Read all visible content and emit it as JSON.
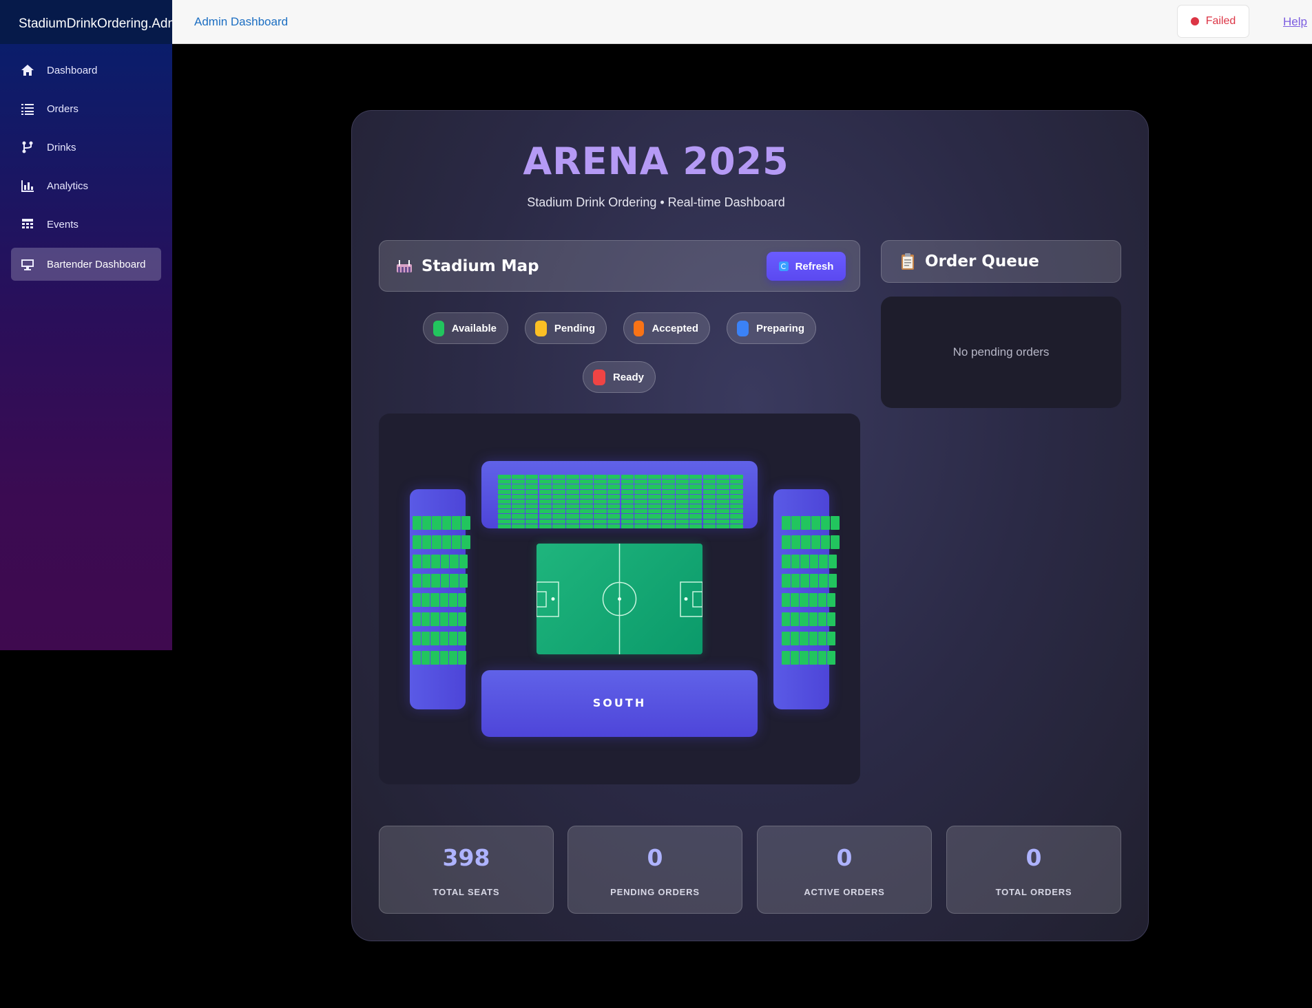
{
  "app": {
    "brand": "StadiumDrinkOrdering.Admin"
  },
  "topbar": {
    "link": "Admin Dashboard",
    "status": "Failed",
    "help": "Help",
    "status_color": "#dc3545"
  },
  "sidebar": {
    "items": [
      {
        "label": "Dashboard",
        "icon": "home-icon"
      },
      {
        "label": "Orders",
        "icon": "list-icon"
      },
      {
        "label": "Drinks",
        "icon": "fork-icon"
      },
      {
        "label": "Analytics",
        "icon": "bar-chart-icon"
      },
      {
        "label": "Events",
        "icon": "calendar-grid-icon"
      },
      {
        "label": "Bartender Dashboard",
        "icon": "monitor-icon",
        "active": true
      }
    ]
  },
  "header": {
    "title": "ARENA 2025",
    "subtitle": "Stadium Drink Ordering • Real-time Dashboard"
  },
  "map_card": {
    "title": "Stadium Map",
    "refresh": "Refresh",
    "icon": "stadium-icon"
  },
  "queue_card": {
    "title": "Order Queue",
    "empty": "No pending orders",
    "icon": "clipboard-icon"
  },
  "legend": [
    {
      "label": "Available",
      "color": "#22c55e"
    },
    {
      "label": "Pending",
      "color": "#fbbf24"
    },
    {
      "label": "Accepted",
      "color": "#f97316"
    },
    {
      "label": "Preparing",
      "color": "#3b82f6"
    },
    {
      "label": "Ready",
      "color": "#ef4444"
    }
  ],
  "map": {
    "south_label": "SOUTH",
    "seat_color": "#22c55e"
  },
  "stats": [
    {
      "value": "398",
      "label": "TOTAL SEATS"
    },
    {
      "value": "0",
      "label": "PENDING ORDERS"
    },
    {
      "value": "0",
      "label": "ACTIVE ORDERS"
    },
    {
      "value": "0",
      "label": "TOTAL ORDERS"
    }
  ]
}
